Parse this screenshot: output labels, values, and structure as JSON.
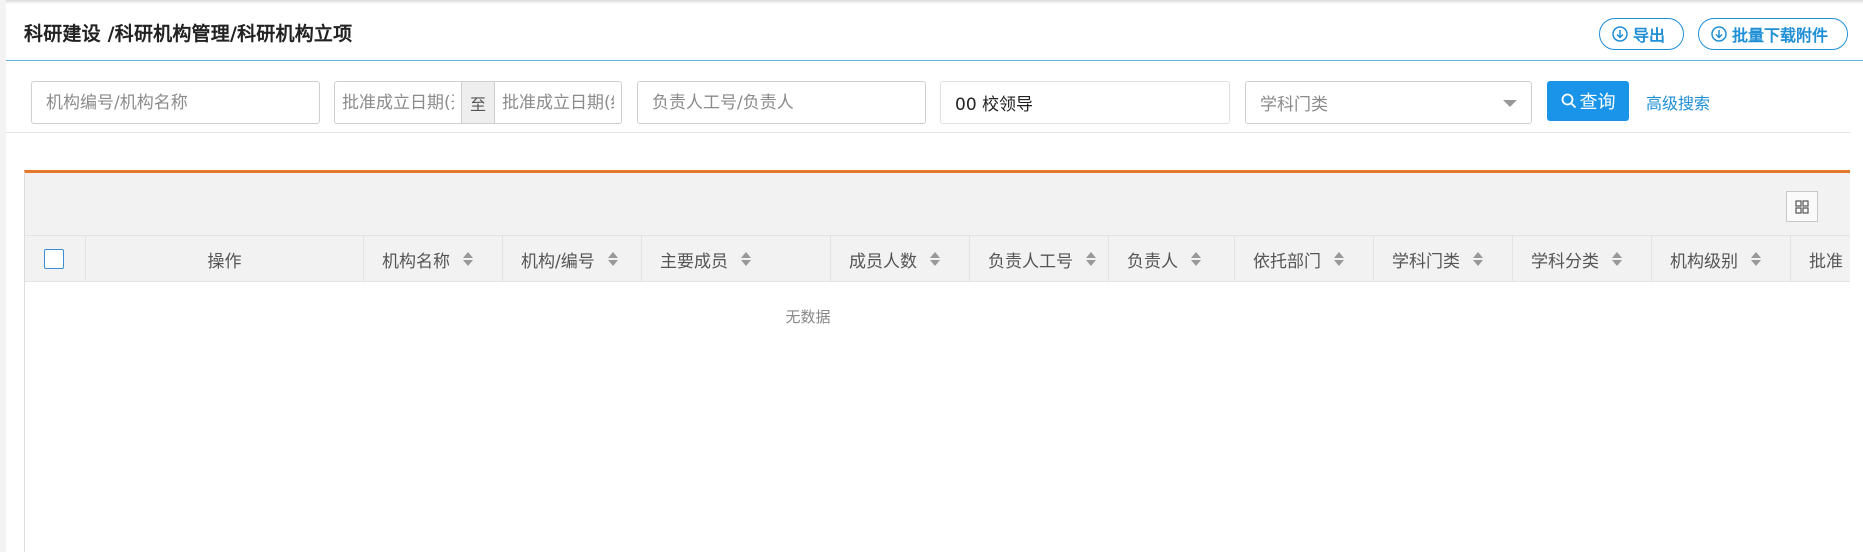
{
  "header": {
    "breadcrumb": "科研建设 /科研机构管理/科研机构立项",
    "export_label": "导出",
    "batch_download_label": "批量下载附件"
  },
  "filters": {
    "org_placeholder": "机构编号/机构名称",
    "date_start_placeholder": "批准成立日期(开始)",
    "date_separator": "至",
    "date_end_placeholder": "批准成立日期(结束)",
    "leader_placeholder": "负责人工号/负责人",
    "school_leader_value": "00 校领导",
    "discipline_placeholder": "学科门类",
    "query_label": "查询",
    "advanced_label": "高级搜索"
  },
  "table": {
    "columns": {
      "op": "操作",
      "name": "机构名称",
      "code": "机构/编号",
      "members": "主要成员",
      "member_count": "成员人数",
      "leader_id": "负责人工号",
      "leader": "负责人",
      "dept": "依托部门",
      "category": "学科门类",
      "classification": "学科分类",
      "level": "机构级别",
      "approved": "批准"
    },
    "empty_text": "无数据"
  },
  "icons": {
    "export": "download-circle-icon",
    "batch": "download-circle-icon",
    "query": "search-icon",
    "grid": "grid-icon"
  },
  "colors": {
    "accent": "#1a94e9",
    "table_top_border": "#e8772e",
    "header_rule": "#5fb6e6"
  }
}
